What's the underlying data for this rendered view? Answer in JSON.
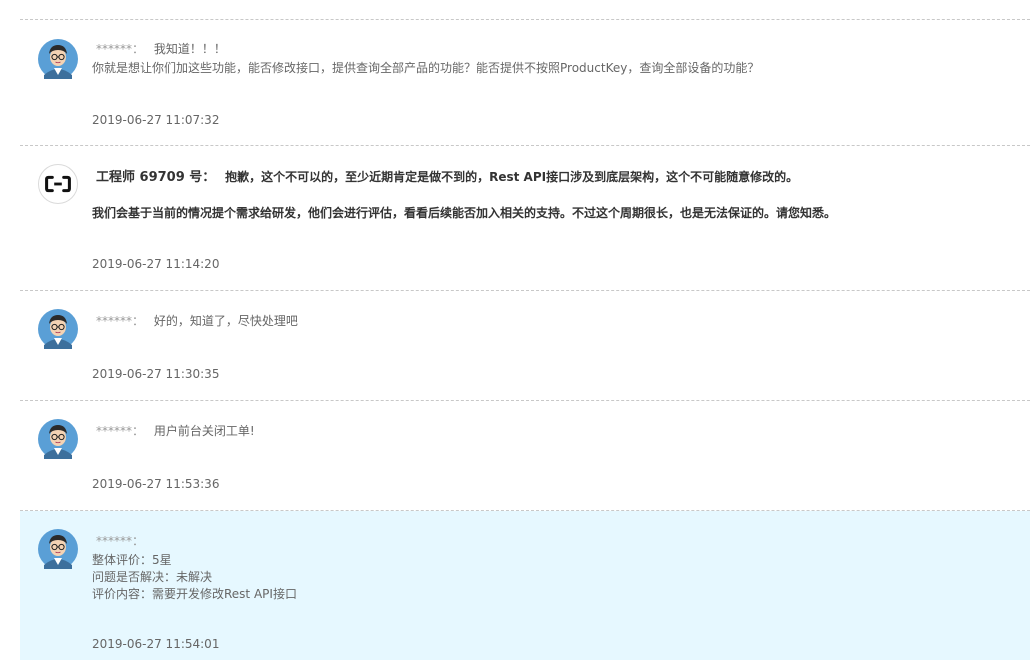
{
  "messages": [
    {
      "name": "******：",
      "content": "我知道！！！",
      "line2": "你就是想让你们加这些功能，能否修改接口，提供查询全部产品的功能？能否提供不按照ProductKey，查询全部设备的功能？",
      "time": "2019-06-27 11:07:32"
    },
    {
      "name": "工程师 69709 号：",
      "content": "抱歉，这个不可以的，至少近期肯定是做不到的，Rest API接口涉及到底层架构，这个不可能随意修改的。",
      "line2": "我们会基于当前的情况提个需求给研发，他们会进行评估，看看后续能否加入相关的支持。不过这个周期很长，也是无法保证的。请您知悉。",
      "time": "2019-06-27 11:14:20"
    },
    {
      "name": "******：",
      "content": "好的，知道了，尽快处理吧",
      "time": "2019-06-27 11:30:35"
    },
    {
      "name": "******：",
      "content": "用户前台关闭工单!",
      "time": "2019-06-27 11:53:36"
    },
    {
      "name": "******：",
      "content": "",
      "rating": "整体评价：5星",
      "resolved": "问题是否解决：未解决",
      "comment": "评价内容：需要开发修改Rest API接口",
      "time": "2019-06-27 11:54:01"
    }
  ],
  "colors": {
    "highlight_bg": "#e6f8ff",
    "divider": "#c8c8c8",
    "avatar_bg": "#5a9fd6"
  },
  "icons": {
    "user_avatar": "user-avatar-icon",
    "engineer_avatar": "aliyun-logo-icon"
  }
}
